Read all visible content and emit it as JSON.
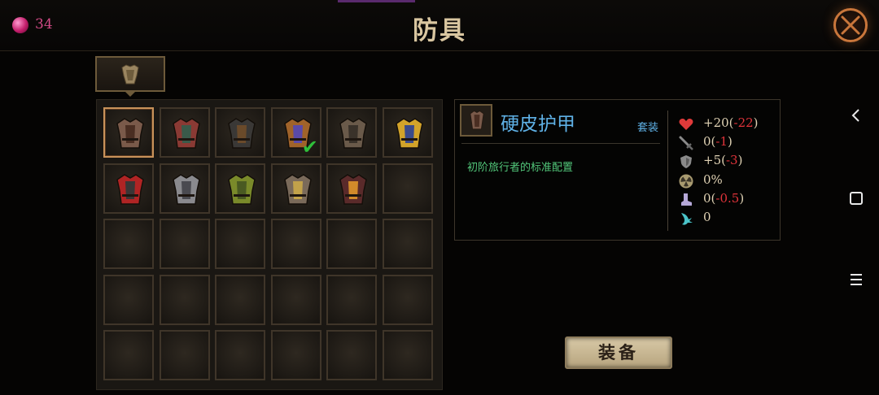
{
  "header": {
    "gem_count": "34",
    "title": "防具"
  },
  "inventory": {
    "slots": [
      {
        "filled": true,
        "selected": true,
        "equipped": false,
        "palette": [
          "#7a5a4a",
          "#4a2e22"
        ]
      },
      {
        "filled": true,
        "selected": false,
        "equipped": false,
        "palette": [
          "#8a3a34",
          "#3a5a4a"
        ]
      },
      {
        "filled": true,
        "selected": false,
        "equipped": false,
        "palette": [
          "#3a3836",
          "#6a4a2a"
        ]
      },
      {
        "filled": true,
        "selected": false,
        "equipped": true,
        "palette": [
          "#a0632a",
          "#5a4aa8"
        ]
      },
      {
        "filled": true,
        "selected": false,
        "equipped": false,
        "palette": [
          "#6a5a4a",
          "#3a322a"
        ]
      },
      {
        "filled": true,
        "selected": false,
        "equipped": false,
        "palette": [
          "#d2a32a",
          "#3a4a8a"
        ]
      },
      {
        "filled": true,
        "selected": false,
        "equipped": false,
        "palette": [
          "#b02424",
          "#3a3636"
        ]
      },
      {
        "filled": true,
        "selected": false,
        "equipped": false,
        "palette": [
          "#8a8a8e",
          "#4a4a50"
        ]
      },
      {
        "filled": true,
        "selected": false,
        "equipped": false,
        "palette": [
          "#7a8a2a",
          "#4a5a22"
        ]
      },
      {
        "filled": true,
        "selected": false,
        "equipped": false,
        "palette": [
          "#7a6a5a",
          "#c2a24a"
        ]
      },
      {
        "filled": true,
        "selected": false,
        "equipped": false,
        "palette": [
          "#5a2a2a",
          "#d28a2a"
        ]
      },
      {
        "filled": false
      },
      {
        "filled": false
      },
      {
        "filled": false
      },
      {
        "filled": false
      },
      {
        "filled": false
      },
      {
        "filled": false
      },
      {
        "filled": false
      },
      {
        "filled": false
      },
      {
        "filled": false
      },
      {
        "filled": false
      },
      {
        "filled": false
      },
      {
        "filled": false
      },
      {
        "filled": false
      },
      {
        "filled": false
      },
      {
        "filled": false
      },
      {
        "filled": false
      },
      {
        "filled": false
      },
      {
        "filled": false
      },
      {
        "filled": false
      }
    ]
  },
  "detail": {
    "name": "硬皮护甲",
    "set_label": "套装",
    "description": "初阶旅行者的标准配置",
    "stats": [
      {
        "icon": "heart-icon",
        "base": "+20(",
        "delta": "-22",
        "close": ")"
      },
      {
        "icon": "sword-icon",
        "base": "0(",
        "delta": "-1",
        "close": ")"
      },
      {
        "icon": "shield-icon",
        "base": "+5(",
        "delta": "-3",
        "close": ")"
      },
      {
        "icon": "radiation-icon",
        "base": "0%",
        "delta": "",
        "close": ""
      },
      {
        "icon": "boot-icon",
        "base": "0(",
        "delta": "-0.5",
        "close": ")"
      },
      {
        "icon": "claw-icon",
        "base": "0",
        "delta": "",
        "close": ""
      }
    ]
  },
  "actions": {
    "equip_label": "装备"
  },
  "colors": {
    "accent_gold": "#c8925a",
    "name_blue": "#5fb1e6",
    "desc_green": "#52c77a",
    "negative_red": "#e0333a"
  }
}
